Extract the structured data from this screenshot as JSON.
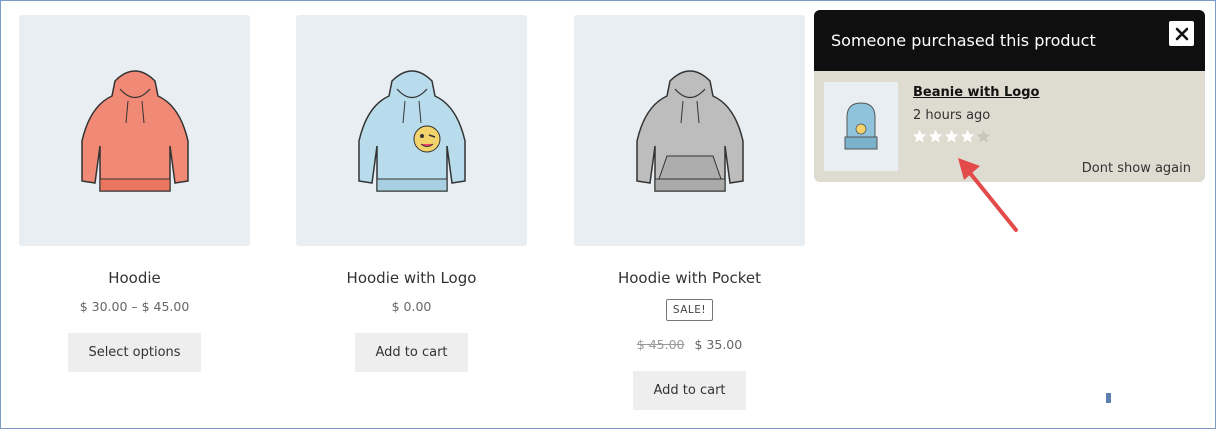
{
  "products": [
    {
      "name": "Hoodie",
      "price": "$ 30.00 – $ 45.00",
      "button": "Select options",
      "image_icon": "hoodie-red-icon",
      "color": "#f08a76"
    },
    {
      "name": "Hoodie with Logo",
      "price": "$ 0.00",
      "button": "Add to cart",
      "image_icon": "hoodie-logo-icon",
      "color": "#b9dcec"
    },
    {
      "name": "Hoodie with Pocket",
      "sale_badge": "SALE!",
      "old_price": "$ 45.00",
      "price": "$ 35.00",
      "button": "Add to cart",
      "image_icon": "hoodie-pocket-icon",
      "color": "#bdbdbd"
    }
  ],
  "popup": {
    "title": "Someone purchased this product",
    "product_link": "Beanie with Logo",
    "time_ago": "2 hours ago",
    "rating": 4,
    "rating_max": 5,
    "dont_show": "Dont show again",
    "close_icon": "close-icon",
    "thumb_icon": "beanie-icon"
  },
  "colors": {
    "popup_header_bg": "#0f0f0f",
    "popup_body_bg": "#dedbd0",
    "arrow": "#e34a4a",
    "button_bg": "#eeeeee",
    "image_bg": "#e8eef2"
  }
}
